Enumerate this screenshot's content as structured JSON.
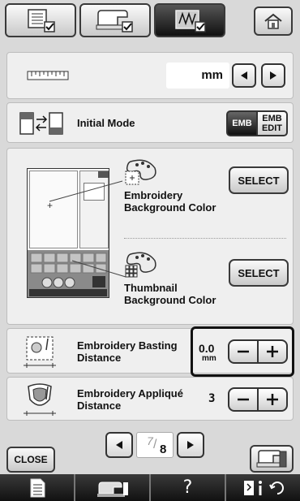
{
  "toolbar": {
    "tabs": [
      "general-settings-icon",
      "sewing-settings-icon",
      "embroidery-settings-icon"
    ],
    "home_icon": "home-icon"
  },
  "units_row": {
    "value": "mm"
  },
  "initial_mode": {
    "label": "Initial Mode",
    "emb_label": "EMB",
    "emb_edit_label": "EMB\nEDIT"
  },
  "background_colors": {
    "embroidery_label": "Embroidery\nBackground Color",
    "thumbnail_label": "Thumbnail\nBackground Color",
    "select_label": "SELECT"
  },
  "basting": {
    "label": "Embroidery Basting\nDistance",
    "value": "0.0",
    "unit": "mm"
  },
  "applique": {
    "label": "Embroidery Appliqué\nDistance",
    "value": "3"
  },
  "pager": {
    "current": "7",
    "total": "8"
  },
  "close_label": "CLOSE",
  "bottom_bar": {
    "help_label": "?"
  }
}
